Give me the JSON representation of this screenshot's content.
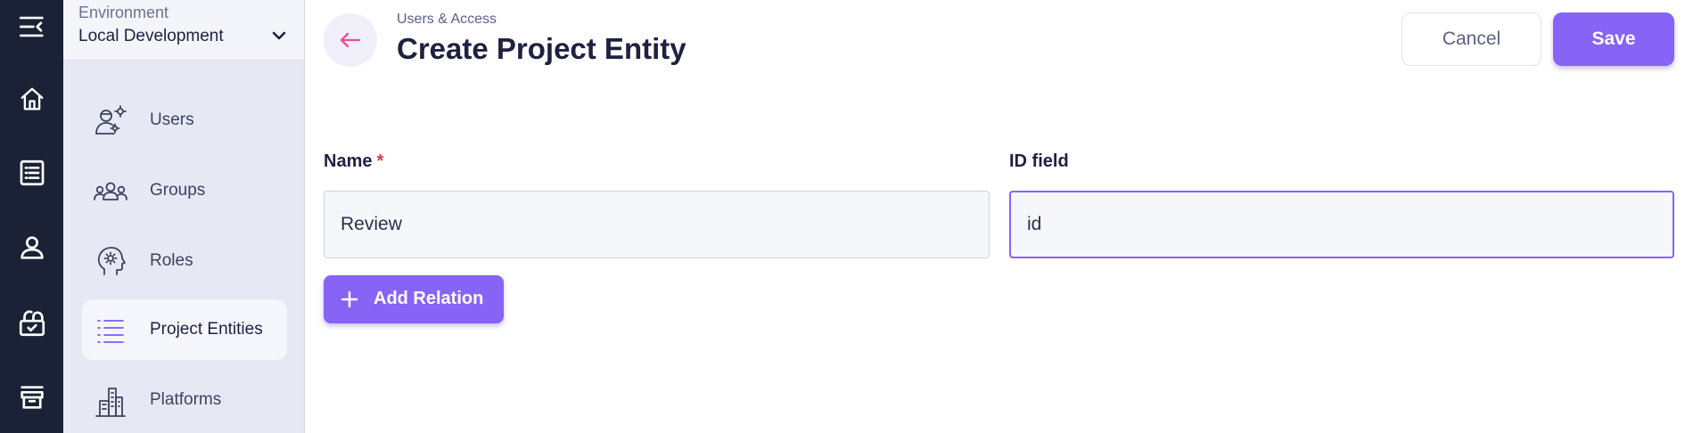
{
  "rail": {
    "items": [
      {
        "icon": "collapse-menu-icon"
      },
      {
        "icon": "home-icon"
      },
      {
        "icon": "list-icon"
      },
      {
        "icon": "user-icon"
      },
      {
        "icon": "lock-icon"
      },
      {
        "icon": "archive-icon"
      }
    ]
  },
  "sidebar": {
    "environment": {
      "label": "Environment",
      "value": "Local Development"
    },
    "items": [
      {
        "label": "Users",
        "icon": "users-gear-icon"
      },
      {
        "label": "Groups",
        "icon": "groups-icon"
      },
      {
        "label": "Roles",
        "icon": "roles-head-icon"
      },
      {
        "label": "Project Entities",
        "icon": "list-icon",
        "active": true
      },
      {
        "label": "Platforms",
        "icon": "buildings-icon"
      }
    ]
  },
  "header": {
    "breadcrumb": "Users & Access",
    "title": "Create Project Entity",
    "cancel_label": "Cancel",
    "save_label": "Save"
  },
  "form": {
    "name_label": "Name",
    "name_required_mark": "*",
    "name_value": "Review",
    "id_label": "ID field",
    "id_value": "id",
    "add_relation_label": "Add Relation"
  },
  "colors": {
    "accent": "#8763f6",
    "rail_bg": "#1b2235",
    "sidebar_bg": "#e6e8f3",
    "back_arrow": "#ec4f8e",
    "required": "#e5334b"
  }
}
